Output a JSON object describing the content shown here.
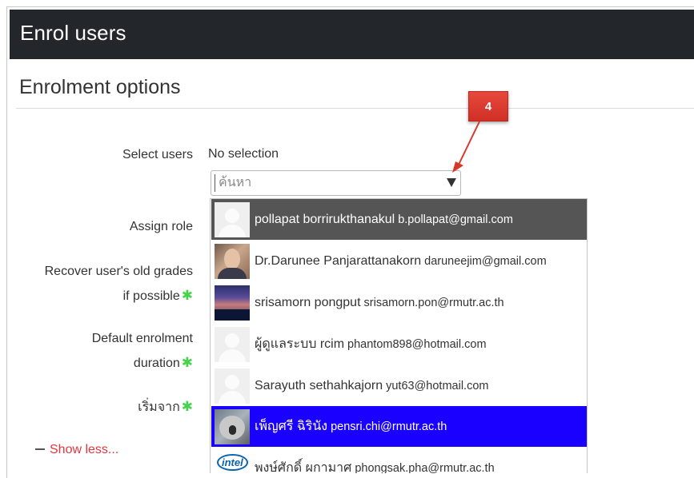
{
  "page": {
    "title": "Enrol users",
    "section_title": "Enrolment options"
  },
  "form": {
    "select_users_label": "Select users",
    "no_selection": "No selection",
    "search_placeholder": "ค้นหา",
    "assign_role_label": "Assign role",
    "recover_grades_label_line1": "Recover user's old grades",
    "recover_grades_label_line2": "if possible",
    "default_duration_label_line1": "Default enrolment",
    "default_duration_label_line2": "duration",
    "start_from_label": "เริ่มจาก",
    "show_less": "Show less..."
  },
  "dropdown": {
    "options": [
      {
        "name": "pollapat borrirukthanakul",
        "email": "b.pollapat@gmail.com",
        "avatar": "default-avatar-icon"
      },
      {
        "name": "Dr.Darunee Panjarattanakorn",
        "email": "daruneejim@gmail.com",
        "avatar": "user-photo"
      },
      {
        "name": "srisamorn pongput",
        "email": "srisamorn.pon@rmutr.ac.th",
        "avatar": "user-photo"
      },
      {
        "name": "ผู้ดูแลระบบ rcim",
        "email": "phantom898@hotmail.com",
        "avatar": "default-avatar-icon"
      },
      {
        "name": "Sarayuth sethahkajorn",
        "email": "yut63@hotmail.com",
        "avatar": "default-avatar-icon"
      },
      {
        "name": "เพ็ญศรี ฉิรินัง",
        "email": "pensri.chi@rmutr.ac.th",
        "avatar": "user-photo"
      },
      {
        "name": "พงษ์ศักดิ์ ผกามาศ",
        "email": "phongsak.pha@rmutr.ac.th",
        "avatar": "user-photo"
      }
    ],
    "highlight_colors": {
      "hover": "#555555",
      "selected": "#1a00ff"
    }
  },
  "annotation": {
    "callout_label": "4",
    "callout_color": "#d9362b"
  },
  "colors": {
    "header_bg": "#23272b",
    "required_icon": "#44d34a",
    "link_red": "#e3363d"
  }
}
